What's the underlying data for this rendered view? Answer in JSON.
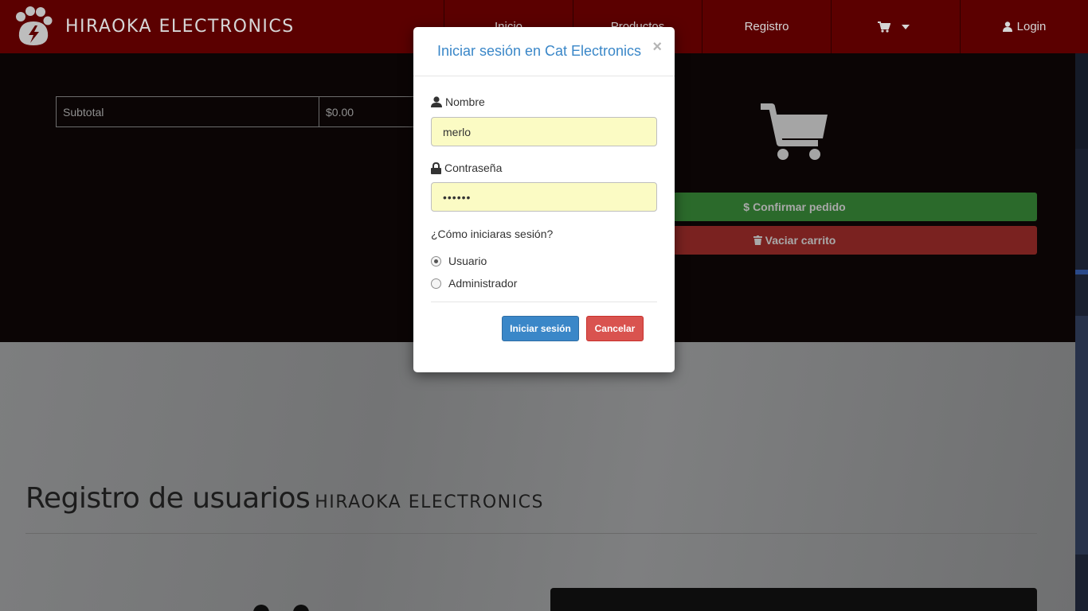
{
  "brand": {
    "name": "HIRAOKA ELECTRONICS"
  },
  "nav": {
    "inicio": "Inicio",
    "productos": "Productos",
    "registro": "Registro",
    "login": "Login"
  },
  "cart": {
    "subtotal_label": "Subtotal",
    "subtotal_value": "$0.00",
    "confirm_label": "Confirmar pedido",
    "empty_label": "Vaciar carrito"
  },
  "register": {
    "title": "Registro de usuarios",
    "brand_sub": "HIRAOKA ELECTRONICS"
  },
  "modal": {
    "title": "Iniciar sesión en Cat Electronics",
    "close": "×",
    "name_label": "Nombre",
    "name_value": "merlo",
    "password_label": "Contraseña",
    "password_value": "••••••",
    "question": "¿Cómo iniciaras sesión?",
    "option_user": "Usuario",
    "option_admin": "Administrador",
    "selected": "Usuario",
    "login_button": "Iniciar sesión",
    "cancel_button": "Cancelar"
  },
  "colors": {
    "navbar": "#5b0000",
    "accent": "#3a87c8",
    "danger": "#d9534f",
    "input_autofill": "#fbfbc4"
  }
}
